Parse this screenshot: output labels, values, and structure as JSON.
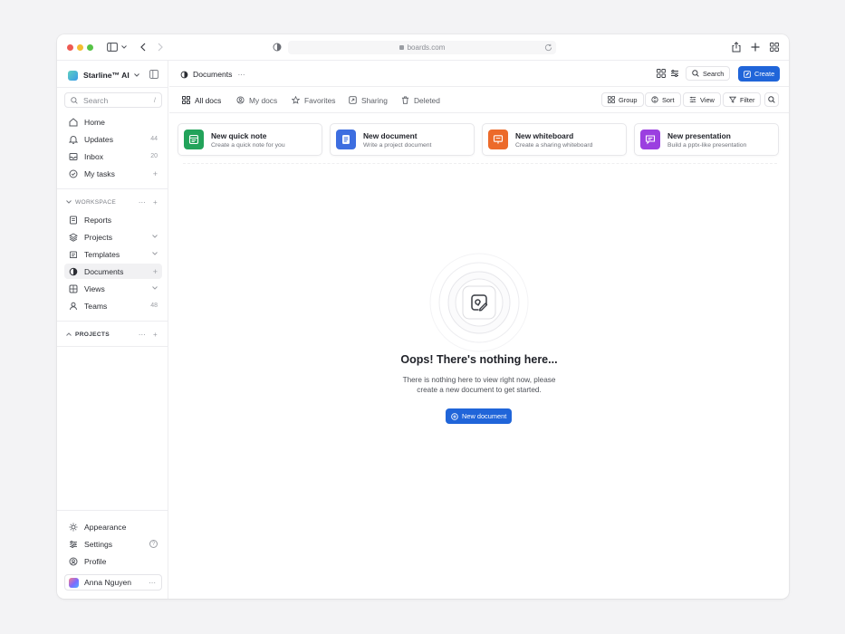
{
  "browser": {
    "url": "boards.com"
  },
  "sidebar": {
    "workspace_name": "Starline™ AI",
    "search_placeholder": "Search",
    "search_shortcut": "/",
    "primary_items": [
      {
        "label": "Home",
        "icon": "home-icon",
        "badge": ""
      },
      {
        "label": "Updates",
        "icon": "bell-icon",
        "badge": "44"
      },
      {
        "label": "Inbox",
        "icon": "inbox-icon",
        "badge": "20"
      },
      {
        "label": "My tasks",
        "icon": "task-icon",
        "badge": "+"
      }
    ],
    "workspace_heading": "WORKSPACE",
    "workspace_items": [
      {
        "label": "Reports",
        "icon": "report-icon",
        "badge": ""
      },
      {
        "label": "Projects",
        "icon": "layers-icon",
        "badge": "⌄"
      },
      {
        "label": "Templates",
        "icon": "template-icon",
        "badge": "⌄"
      },
      {
        "label": "Documents",
        "icon": "document-icon",
        "badge": "+"
      },
      {
        "label": "Views",
        "icon": "grid-icon",
        "badge": "⌄"
      },
      {
        "label": "Teams",
        "icon": "user-icon",
        "badge": "48"
      }
    ],
    "projects_heading": "PROJECTS",
    "bottom_items": [
      {
        "label": "Appearance",
        "icon": "sun-icon",
        "badge": ""
      },
      {
        "label": "Settings",
        "icon": "sliders-icon",
        "badge": "?"
      },
      {
        "label": "Profile",
        "icon": "profile-icon",
        "badge": ""
      }
    ],
    "user_name": "Anna Nguyen"
  },
  "header": {
    "breadcrumb": "Documents",
    "search_label": "Search",
    "create_label": "Create"
  },
  "tabs": [
    {
      "label": "All docs",
      "icon": "grid-icon"
    },
    {
      "label": "My docs",
      "icon": "user-circle-icon"
    },
    {
      "label": "Favorites",
      "icon": "star-icon"
    },
    {
      "label": "Sharing",
      "icon": "share-icon"
    },
    {
      "label": "Deleted",
      "icon": "trash-icon"
    }
  ],
  "toolbar": {
    "group_label": "Group",
    "sort_label": "Sort",
    "view_label": "View",
    "filter_label": "Filter"
  },
  "cards": [
    {
      "title": "New quick note",
      "subtitle": "Create a quick note for you",
      "color": "#22a35a",
      "icon": "note-icon"
    },
    {
      "title": "New document",
      "subtitle": "Write a project document",
      "color": "#3d6ee0",
      "icon": "document-icon"
    },
    {
      "title": "New whiteboard",
      "subtitle": "Create a sharing whiteboard",
      "color": "#ec6a2a",
      "icon": "whiteboard-icon"
    },
    {
      "title": "New presentation",
      "subtitle": "Build a pptx-like presentation",
      "color": "#9b3fe0",
      "icon": "presentation-icon"
    }
  ],
  "empty_state": {
    "title": "Oops! There's nothing here...",
    "line1": "There is nothing here to view right now, please",
    "line2": "create a new document to get started.",
    "button_label": "New document"
  },
  "colors": {
    "accent": "#2065d9",
    "traffic_red": "#ee5a52",
    "traffic_yellow": "#f4bd30",
    "traffic_green": "#56c346"
  }
}
